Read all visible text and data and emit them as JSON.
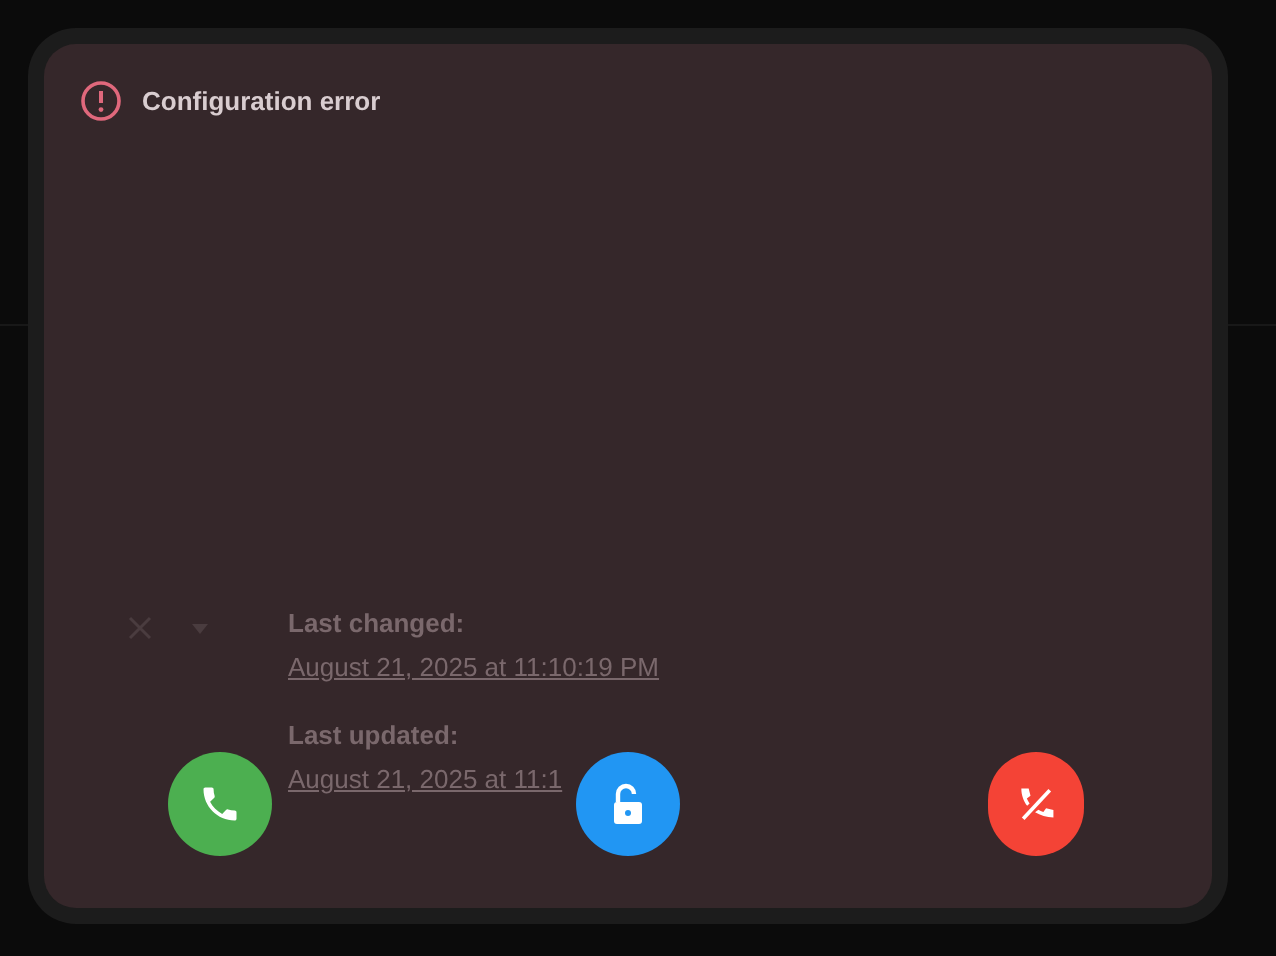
{
  "dialog": {
    "title": "Configuration error"
  },
  "background": {
    "fields": [
      {
        "label": "Last changed:",
        "value": "August 21, 2025 at 11:10:19 PM"
      },
      {
        "label": "Last updated:",
        "value": "August 21, 2025 at 11:1"
      }
    ]
  },
  "actions": [
    {
      "kind": "answer",
      "color": "#4caf50"
    },
    {
      "kind": "unlock",
      "color": "#2196f3"
    },
    {
      "kind": "hangup",
      "color": "#f44336"
    }
  ]
}
